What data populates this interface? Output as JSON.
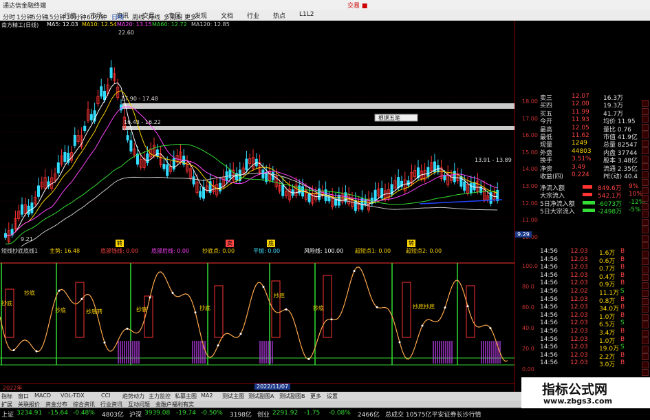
{
  "app": {
    "title": "通达信金融终端",
    "menu": [
      "行情",
      "市场",
      "资讯",
      "交易",
      "专区",
      "发现",
      "文档",
      "行业",
      "热点",
      "L1L2"
    ],
    "corner": "交易 ■"
  },
  "periods": [
    "分时",
    "1分钟",
    "5分钟",
    "15分钟",
    "30分钟",
    "60分钟",
    "日线",
    "周线",
    "月线",
    "多周期",
    "更多"
  ],
  "stock": {
    "name": "南方精工(日线)",
    "ma": [
      {
        "label": "MA5: 12.03",
        "color": "#ffffff"
      },
      {
        "label": "MA10: 12.54",
        "color": "#ffd700"
      },
      {
        "label": "MA20: 13.15",
        "color": "#ff44ff"
      },
      {
        "label": "MA60: 12.72",
        "color": "#33dd33"
      },
      {
        "label": "MA120: 12.85",
        "color": "#c8c8c8"
      }
    ]
  },
  "chart_annotations": {
    "high": "22.60",
    "low": "9.21",
    "band1": "17.90 - 17.48",
    "band2": "16.43 - 16.22",
    "band3": "13.91 - 13.89",
    "popup": "根据五笔",
    "date": "2022/11/07",
    "year": "2022年"
  },
  "price_axis": [
    "18.00",
    "17.00",
    "16.00",
    "15.00",
    "14.00",
    "13.00",
    "12.00",
    "11.00",
    "10.00"
  ],
  "price_tag": "9.29",
  "signals": [
    "转",
    "卖",
    "底",
    "转"
  ],
  "indicator": {
    "name": "短线抄底底线1",
    "items": [
      {
        "label": "主势: 16.48",
        "color": "#ffd700"
      },
      {
        "label": "底部钱线: 0.00",
        "color": "#ff4444"
      },
      {
        "label": "底部后线: 0.00",
        "color": "#ff44ff"
      },
      {
        "label": "抄底点: 0.00",
        "color": "#ffd700"
      },
      {
        "label": "平抛: 0.00",
        "color": "#44ddff"
      },
      {
        "label": "风险线: 100.00",
        "color": "#ffffff"
      },
      {
        "label": "超短点1: 0.00",
        "color": "#ffd700"
      },
      {
        "label": "超短点2: 0.00",
        "color": "#ffd700"
      }
    ],
    "axis": [
      "100.0",
      "80.0",
      "60.0",
      "40.0",
      "20.0",
      "0.00"
    ],
    "labels": [
      "抄底",
      "抄底",
      "抄底",
      "抄底转",
      "抄底",
      "抄底",
      "抄底",
      "抄底",
      "抄底抄底"
    ]
  },
  "quotes": [
    {
      "k": "卖三",
      "v": "12.07",
      "v2": "16.3万"
    },
    {
      "k": "买四",
      "v": "12.00",
      "v2": "19.3万"
    },
    {
      "k": "买五",
      "v": "11.99",
      "v2": "41.7万"
    },
    {
      "k": "今开",
      "v": "11.93",
      "v2": "均价 11.95"
    },
    {
      "k": "最高",
      "v": "12.05",
      "v2": "量比 0.76"
    },
    {
      "k": "最低",
      "v": "11.62",
      "v2": "市值 41.9亿"
    },
    {
      "k": "现量",
      "v": "1249",
      "v2": "总量 82547"
    },
    {
      "k": "外盘",
      "v": "44803",
      "v2": "内盘 37744"
    },
    {
      "k": "换手",
      "v": "3.51%",
      "v2": "股本 3.48亿"
    },
    {
      "k": "净资",
      "v": "3.49",
      "v2": "流通 2.35亿"
    },
    {
      "k": "收益(四)",
      "v": "0.224",
      "v2": "PE(动) 40.4"
    }
  ],
  "flows": [
    {
      "k": "净流入额",
      "v": "849.6万",
      "v2": "9%"
    },
    {
      "k": "大宗流入",
      "v": "542.1万",
      "v2": "10%"
    },
    {
      "k": "5日净流入额",
      "v": "-6073万",
      "v2": "-12%"
    },
    {
      "k": "5日大宗流入",
      "v": "-2498万",
      "v2": "-5%"
    }
  ],
  "ticks": [
    {
      "t": "14:56",
      "p": "12.03",
      "v": "1.6万",
      "d": "B"
    },
    {
      "t": "14:56",
      "p": "12.03",
      "v": "0.6万",
      "d": "B"
    },
    {
      "t": "14:56",
      "p": "12.03",
      "v": "0.7万",
      "d": "B"
    },
    {
      "t": "14:56",
      "p": "12.03",
      "v": "0.4万",
      "d": "B"
    },
    {
      "t": "14:56",
      "p": "12.03",
      "v": "0.9万",
      "d": "B"
    },
    {
      "t": "14:56",
      "p": "12.02",
      "v": "11.1万",
      "d": "S"
    },
    {
      "t": "14:56",
      "p": "12.03",
      "v": "0.8万",
      "d": "B"
    },
    {
      "t": "14:56",
      "p": "12.03",
      "v": "34.0万",
      "d": "B"
    },
    {
      "t": "14:56",
      "p": "12.03",
      "v": "1.0万",
      "d": "B"
    },
    {
      "t": "14:56",
      "p": "12.03",
      "v": "6.5万",
      "d": "S"
    },
    {
      "t": "14:56",
      "p": "12.03",
      "v": "3.4万",
      "d": "B"
    },
    {
      "t": "14:56",
      "p": "12.03",
      "v": "1.0万",
      "d": "B"
    },
    {
      "t": "14:56",
      "p": "12.03",
      "v": "19.0万",
      "d": "S"
    },
    {
      "t": "14:56",
      "p": "12.03",
      "v": "2.2万",
      "d": "B"
    },
    {
      "t": "14:56",
      "p": "12.03",
      "v": "3.0万",
      "d": "B"
    }
  ],
  "bottom_tabs": [
    "指标",
    "窗口",
    "MACD",
    "VOL-TDX",
    "CCI",
    "趋势动力",
    "主力监控",
    "私募主图",
    "MA2",
    "测试主图",
    "测试副图A",
    "测试副图B",
    "更多",
    "设置"
  ],
  "bottom_tabs2": [
    "扩展",
    "关联报价",
    "资金分布",
    "综合资讯",
    "行业资讯",
    "互动问题",
    "金融户福利有奖"
  ],
  "status": [
    {
      "label": "上证",
      "val": "3234.91",
      "chg": "-15.64",
      "pct": "-0.48%",
      "amt": "4803亿"
    },
    {
      "label": "沪深",
      "val": "3939.08",
      "chg": "-19.74",
      "pct": "-0.50%",
      "amt": "3198亿"
    },
    {
      "label": "创业",
      "val": "2291.92",
      "chg": "-1.75",
      "pct": "-0.08%",
      "amt": "2466亿"
    }
  ],
  "status_tail": "总成交 10575亿平安证券长沙行情",
  "watermark": {
    "title": "指标公式网",
    "url": "www.zbgs3.com"
  },
  "colors": {
    "up": "#ff3333",
    "down": "#33ddff",
    "text_yellow": "#ffd700",
    "green": "#33dd33"
  }
}
